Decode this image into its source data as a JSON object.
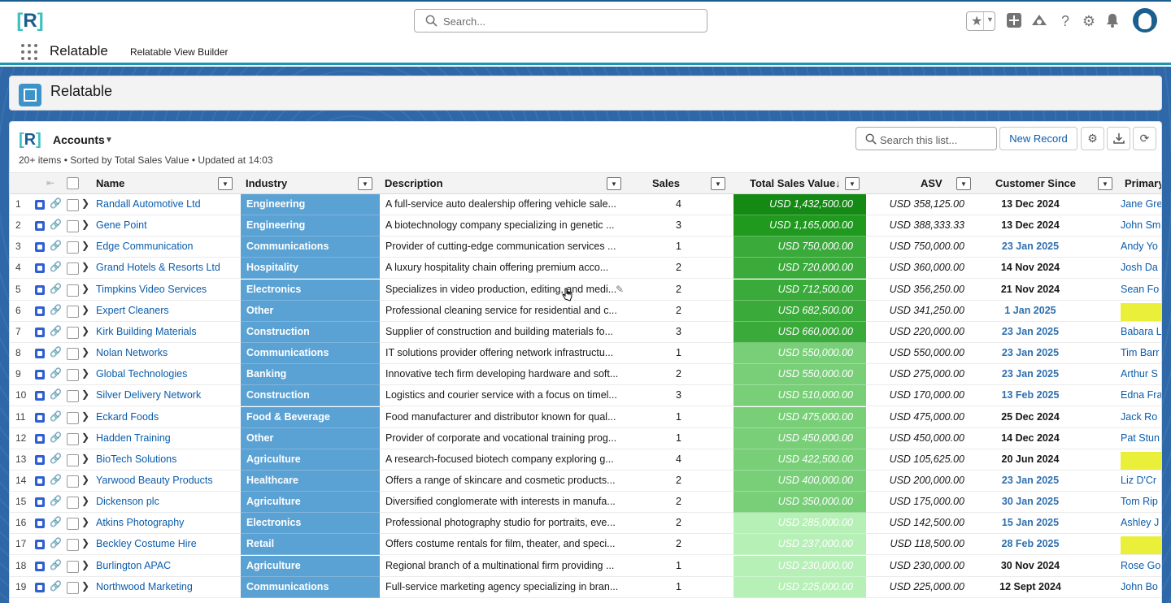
{
  "global_header": {
    "logo_text": "R",
    "search_placeholder": "Search..."
  },
  "app_nav": {
    "app_name": "Relatable",
    "items": [
      "Relatable View Builder"
    ]
  },
  "page_header": {
    "title": "Relatable"
  },
  "list_view": {
    "object_name": "Accounts",
    "meta": "20+ items • Sorted by Total Sales Value • Updated at 14:03",
    "search_placeholder": "Search this list...",
    "new_record_label": "New Record",
    "columns": [
      "Name",
      "Industry",
      "Description",
      "Sales",
      "Total Sales Value",
      "ASV",
      "Customer Since",
      "Primary"
    ],
    "sort_indicator": "↓",
    "rows": [
      {
        "n": "1",
        "name": "Randall Automotive Ltd",
        "industry": "Engineering",
        "desc": "A full-service auto dealership offering vehicle sale...",
        "sales": "4",
        "tsv": "USD 1,432,500.00",
        "asv": "USD 358,125.00",
        "since": "13 Dec 2024",
        "prim": "Jane Gre",
        "tsv_color": "#148a14",
        "since_blue": false,
        "hl": false
      },
      {
        "n": "2",
        "name": "Gene Point",
        "industry": "Engineering",
        "desc": "A biotechnology company specializing in genetic ...",
        "sales": "3",
        "tsv": "USD 1,165,000.00",
        "asv": "USD 388,333.33",
        "since": "13 Dec 2024",
        "prim": "John Sm",
        "tsv_color": "#1f9a1f",
        "since_blue": false,
        "hl": false
      },
      {
        "n": "3",
        "name": "Edge Communication",
        "industry": "Communications",
        "desc": "Provider of cutting-edge communication services ...",
        "sales": "1",
        "tsv": "USD 750,000.00",
        "asv": "USD 750,000.00",
        "since": "23 Jan 2025",
        "prim": "Andy Yo",
        "tsv_color": "#3aaa3a",
        "since_blue": true,
        "hl": false
      },
      {
        "n": "4",
        "name": "Grand Hotels & Resorts Ltd",
        "industry": "Hospitality",
        "desc": "A luxury hospitality chain offering premium acco...",
        "sales": "2",
        "tsv": "USD 720,000.00",
        "asv": "USD 360,000.00",
        "since": "14 Nov 2024",
        "prim": "Josh Da",
        "tsv_color": "#3aaa3a",
        "since_blue": false,
        "hl": false
      },
      {
        "n": "5",
        "name": "Timpkins Video Services",
        "industry": "Electronics",
        "desc": "Specializes in video production, editing, and medi...",
        "sales": "2",
        "tsv": "USD 712,500.00",
        "asv": "USD 356,250.00",
        "since": "21 Nov 2024",
        "prim": "Sean Fo",
        "tsv_color": "#3aaa3a",
        "since_blue": false,
        "hl": false
      },
      {
        "n": "6",
        "name": "Expert Cleaners",
        "industry": "Other",
        "desc": "Professional cleaning service for residential and c...",
        "sales": "2",
        "tsv": "USD 682,500.00",
        "asv": "USD 341,250.00",
        "since": "1 Jan 2025",
        "prim": "",
        "tsv_color": "#3aaa3a",
        "since_blue": true,
        "hl": true
      },
      {
        "n": "7",
        "name": "Kirk Building Materials",
        "industry": "Construction",
        "desc": "Supplier of construction and building materials fo...",
        "sales": "3",
        "tsv": "USD 660,000.00",
        "asv": "USD 220,000.00",
        "since": "23 Jan 2025",
        "prim": "Babara L",
        "tsv_color": "#3aaa3a",
        "since_blue": true,
        "hl": false
      },
      {
        "n": "8",
        "name": "Nolan Networks",
        "industry": "Communications",
        "desc": "IT solutions provider offering network infrastructu...",
        "sales": "1",
        "tsv": "USD 550,000.00",
        "asv": "USD 550,000.00",
        "since": "23 Jan 2025",
        "prim": "Tim Barr",
        "tsv_color": "#78cf78",
        "since_blue": true,
        "hl": false
      },
      {
        "n": "9",
        "name": "Global Technologies",
        "industry": "Banking",
        "desc": "Innovative tech firm developing hardware and soft...",
        "sales": "2",
        "tsv": "USD 550,000.00",
        "asv": "USD 275,000.00",
        "since": "23 Jan 2025",
        "prim": "Arthur S",
        "tsv_color": "#78cf78",
        "since_blue": true,
        "hl": false
      },
      {
        "n": "10",
        "name": "Silver Delivery Network",
        "industry": "Construction",
        "desc": "Logistics and courier service with a focus on timel...",
        "sales": "3",
        "tsv": "USD 510,000.00",
        "asv": "USD 170,000.00",
        "since": "13 Feb 2025",
        "prim": "Edna Fra",
        "tsv_color": "#78cf78",
        "since_blue": true,
        "hl": false
      },
      {
        "n": "11",
        "name": "Eckard Foods",
        "industry": "Food & Beverage",
        "desc": "Food manufacturer and distributor known for qual...",
        "sales": "1",
        "tsv": "USD 475,000.00",
        "asv": "USD 475,000.00",
        "since": "25 Dec 2024",
        "prim": "Jack Ro",
        "tsv_color": "#78cf78",
        "since_blue": false,
        "hl": false
      },
      {
        "n": "12",
        "name": "Hadden Training",
        "industry": "Other",
        "desc": "Provider of corporate and vocational training prog...",
        "sales": "1",
        "tsv": "USD 450,000.00",
        "asv": "USD 450,000.00",
        "since": "14 Dec 2024",
        "prim": "Pat Stun",
        "tsv_color": "#78cf78",
        "since_blue": false,
        "hl": false
      },
      {
        "n": "13",
        "name": "BioTech Solutions",
        "industry": "Agriculture",
        "desc": "A research-focused biotech company exploring g...",
        "sales": "4",
        "tsv": "USD 422,500.00",
        "asv": "USD 105,625.00",
        "since": "20 Jun 2024",
        "prim": "",
        "tsv_color": "#78cf78",
        "since_blue": false,
        "hl": true
      },
      {
        "n": "14",
        "name": "Yarwood Beauty Products",
        "industry": "Healthcare",
        "desc": "Offers a range of skincare and cosmetic products...",
        "sales": "2",
        "tsv": "USD 400,000.00",
        "asv": "USD 200,000.00",
        "since": "23 Jan 2025",
        "prim": "Liz D'Cr",
        "tsv_color": "#78cf78",
        "since_blue": true,
        "hl": false
      },
      {
        "n": "15",
        "name": "Dickenson plc",
        "industry": "Agriculture",
        "desc": "Diversified conglomerate with interests in manufa...",
        "sales": "2",
        "tsv": "USD 350,000.00",
        "asv": "USD 175,000.00",
        "since": "30 Jan 2025",
        "prim": "Tom Rip",
        "tsv_color": "#78cf78",
        "since_blue": true,
        "hl": false
      },
      {
        "n": "16",
        "name": "Atkins Photography",
        "industry": "Electronics",
        "desc": "Professional photography studio for portraits, eve...",
        "sales": "2",
        "tsv": "USD 285,000.00",
        "asv": "USD 142,500.00",
        "since": "15 Jan 2025",
        "prim": "Ashley J",
        "tsv_color": "#b6f0b6",
        "since_blue": true,
        "hl": false
      },
      {
        "n": "17",
        "name": "Beckley Costume Hire",
        "industry": "Retail",
        "desc": "Offers costume rentals for film, theater, and speci...",
        "sales": "2",
        "tsv": "USD 237,000.00",
        "asv": "USD 118,500.00",
        "since": "28 Feb 2025",
        "prim": "",
        "tsv_color": "#b6f0b6",
        "since_blue": true,
        "hl": true
      },
      {
        "n": "18",
        "name": "Burlington APAC",
        "industry": "Agriculture",
        "desc": "Regional branch of a multinational firm providing ...",
        "sales": "1",
        "tsv": "USD 230,000.00",
        "asv": "USD 230,000.00",
        "since": "30 Nov 2024",
        "prim": "Rose Go",
        "tsv_color": "#b6f0b6",
        "since_blue": false,
        "hl": false
      },
      {
        "n": "19",
        "name": "Northwood Marketing",
        "industry": "Communications",
        "desc": "Full-service marketing agency specializing in bran...",
        "sales": "1",
        "tsv": "USD 225,000.00",
        "asv": "USD 225,000.00",
        "since": "12 Sept 2024",
        "prim": "John Bo",
        "tsv_color": "#b6f0b6",
        "since_blue": false,
        "hl": false
      }
    ]
  },
  "colors": {
    "link": "#0b5cab",
    "industry_fill": "#5ba2d4",
    "highlight_yellow": "#eaef3a",
    "date_blue": "#2f6fae"
  }
}
